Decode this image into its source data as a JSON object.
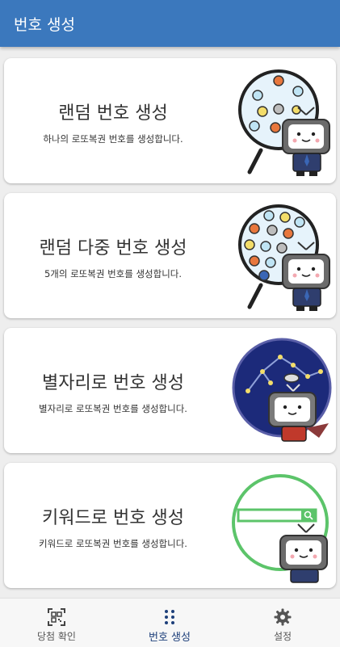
{
  "appbar": {
    "title": "번호 생성"
  },
  "cards": [
    {
      "title": "랜덤 번호 생성",
      "desc": "하나의 로또복권 번호를 생성합니다."
    },
    {
      "title": "랜덤 다중 번호 생성",
      "desc": "5개의 로또복권 번호를 생성합니다."
    },
    {
      "title": "별자리로 번호 생성",
      "desc": "별자리로 로또복권 번호를 생성합니다."
    },
    {
      "title": "키워드로 번호 생성",
      "desc": "키워드로 로또복권 번호를 생성합니다."
    }
  ],
  "bottomnav": {
    "items": [
      {
        "label": "당첨 확인",
        "icon": "qr-scan-icon"
      },
      {
        "label": "번호 생성",
        "icon": "dots-grid-icon",
        "active": true
      },
      {
        "label": "설정",
        "icon": "gear-icon"
      }
    ]
  },
  "colors": {
    "appbar": "#3b78bd",
    "active_nav": "#1d3f7a",
    "constellation_bg": "#1c2a7a",
    "keyword_green": "#5cc46a"
  }
}
